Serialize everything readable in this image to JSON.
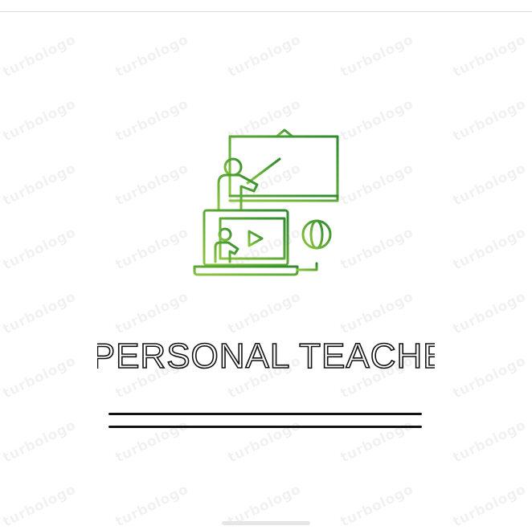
{
  "brand": {
    "name": "A PERSONAL TEACHER",
    "gradient_start": "#2e8b2e",
    "gradient_end": "#8cc63f",
    "text_color": "#111111"
  },
  "watermark": {
    "text": "turbologo"
  },
  "icons": {
    "logo": "teacher-presentation-icon",
    "globe": "globe-icon",
    "play": "play-icon"
  }
}
